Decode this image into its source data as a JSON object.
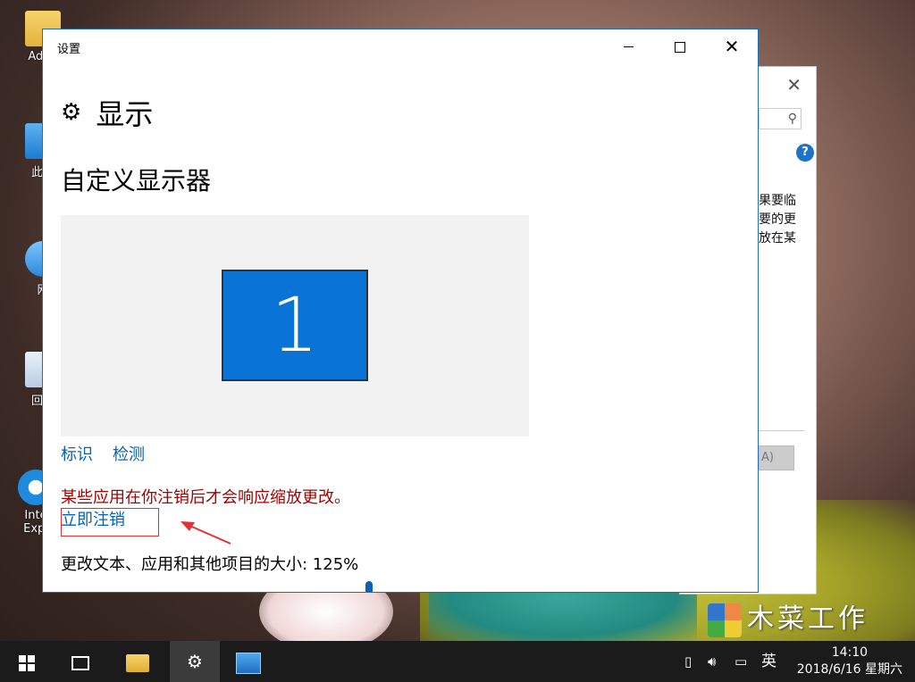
{
  "desktop": {
    "icons": [
      {
        "label": "Admi",
        "icon": "user-folder-icon"
      },
      {
        "label": "此电",
        "icon": "this-pc-icon"
      },
      {
        "label": "网",
        "icon": "network-icon"
      },
      {
        "label": "回收",
        "icon": "recycle-bin-icon"
      },
      {
        "label": "Inte Expl",
        "icon": "internet-explorer-icon"
      }
    ],
    "watermark": "木菜工作室"
  },
  "background_window": {
    "text_lines": [
      "果要临",
      "要的更",
      "放在某"
    ],
    "button_label": "A)",
    "help_label": "?"
  },
  "settings_window": {
    "title": "设置",
    "page_heading": "显示",
    "section_title": "自定义显示器",
    "monitor_number": "1",
    "links": {
      "identify": "标识",
      "detect": "检测"
    },
    "warning": "某些应用在你注销后才会响应缩放更改。",
    "signout_link": "立即注销",
    "size_label": "更改文本、应用和其他项目的大小: 125%"
  },
  "taskbar": {
    "tray_input_language": "英",
    "time": "14:10",
    "date": "2018/6/16 星期六"
  }
}
